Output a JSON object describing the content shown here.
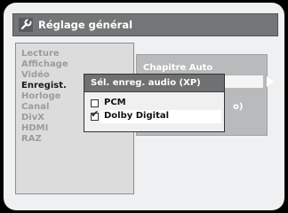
{
  "window": {
    "title": "Réglage général",
    "title_icon": "wrench-icon"
  },
  "left_menu": {
    "items": [
      {
        "label": "Lecture",
        "active": false
      },
      {
        "label": "Affichage",
        "active": false
      },
      {
        "label": "Vidéo",
        "active": false
      },
      {
        "label": "Enregist.",
        "active": true
      },
      {
        "label": "Horloge",
        "active": false
      },
      {
        "label": "Canal",
        "active": false
      },
      {
        "label": "DivX",
        "active": false
      },
      {
        "label": "HDMI",
        "active": false
      },
      {
        "label": "RAZ",
        "active": false
      }
    ]
  },
  "right_panel": {
    "first_item": "Chapitre Auto",
    "partial_text": "o)"
  },
  "popup": {
    "title": "Sél. enreg. audio (XP)",
    "options": [
      {
        "label": "PCM",
        "checked": false
      },
      {
        "label": "Dolby Digital",
        "checked": true
      }
    ]
  },
  "colors": {
    "title_bg": "#747576",
    "panel_bg": "#dcdcdd",
    "active_text": "#1a1a1a",
    "inactive_text": "#9b9c9d"
  }
}
